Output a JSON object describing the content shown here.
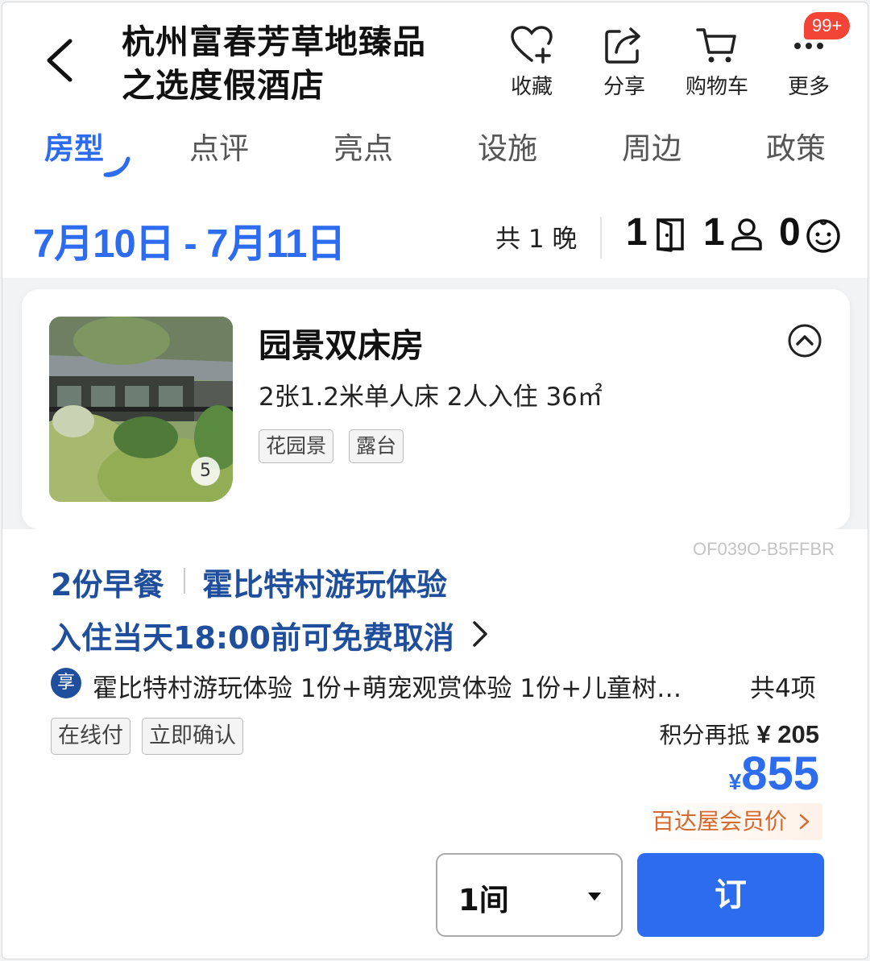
{
  "header": {
    "back_icon": "chevron-left-icon",
    "hotel_name_line1": "杭州富春芳草地臻品",
    "hotel_name_line2": "之选度假酒店",
    "actions": [
      {
        "label": "收藏",
        "icon": "heart-plus-icon"
      },
      {
        "label": "分享",
        "icon": "share-icon"
      },
      {
        "label": "购物车",
        "icon": "cart-icon"
      },
      {
        "label": "更多",
        "icon": "more-icon"
      }
    ],
    "more_badge": "99+"
  },
  "tabs": [
    {
      "label": "房型",
      "active": true
    },
    {
      "label": "点评",
      "active": false
    },
    {
      "label": "亮点",
      "active": false
    },
    {
      "label": "设施",
      "active": false
    },
    {
      "label": "周边",
      "active": false
    },
    {
      "label": "政策",
      "active": false
    }
  ],
  "stay": {
    "dates": "7月10日 - 7月11日",
    "nights": "共 1 晚",
    "rooms": "1",
    "adults": "1",
    "children": "0"
  },
  "room": {
    "name": "园景双床房",
    "spec": "2张1.2米单人床  2人入住  36㎡",
    "photo_count": "5",
    "tags": [
      "花园景",
      "露台"
    ]
  },
  "rate": {
    "code": "OF039O-B5FFBR",
    "breakfast": "2份早餐",
    "experience": "霍比特村游玩体验",
    "cancel_policy": "入住当天18:00前可免费取消",
    "perk_badge": "享",
    "perks": "霍比特村游玩体验 1份+萌宠观赏体验 1份+儿童树…",
    "perk_count": "共4项",
    "pay_tags": [
      "在线付",
      "立即确认"
    ],
    "points_label": "积分再抵",
    "points_value": "¥ 205",
    "currency": "¥",
    "price": "855",
    "member_label": "百达屋会员价",
    "qty": "1间",
    "book_label": "订"
  },
  "colors": {
    "primary": "#2d6bef",
    "dark_blue": "#1f4e9c",
    "member_orange": "#d9682c",
    "badge_red": "#f24437"
  }
}
